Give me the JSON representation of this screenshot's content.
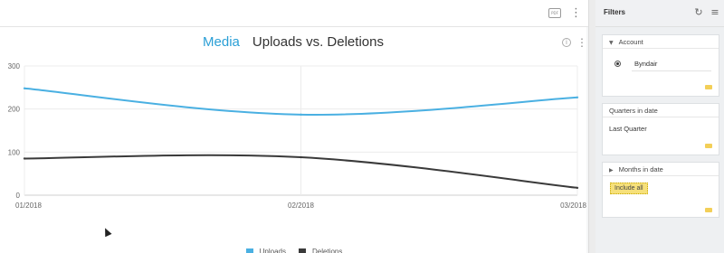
{
  "toolbar": {
    "pdf_label": "PDF",
    "more_label": "⋮"
  },
  "widget": {
    "title_prefix": "Media",
    "title": "Uploads vs. Deletions",
    "info_label": "i",
    "more_label": "⋮"
  },
  "chart_data": {
    "type": "line",
    "title": "Uploads vs. Deletions",
    "x": [
      "01/2018",
      "02/2018",
      "03/2018"
    ],
    "ylim": [
      0,
      300
    ],
    "yticks": [
      0,
      100,
      200,
      300
    ],
    "grid": true,
    "legend": "bottom",
    "series": [
      {
        "name": "Uploads",
        "color": "#4ab0e2",
        "values": [
          248,
          187,
          227
        ]
      },
      {
        "name": "Deletions",
        "color": "#3a3a3a",
        "values": [
          85,
          88,
          17
        ]
      }
    ]
  },
  "filters": {
    "title": "Filters",
    "refresh_icon": "refresh-icon",
    "menu_icon": "menu-icon",
    "account": {
      "label": "Account",
      "selected": "Byndair"
    },
    "quarters": {
      "label": "Quarters in date",
      "value": "Last Quarter"
    },
    "months": {
      "label": "Months in date",
      "chip": "Include all"
    }
  },
  "colors": {
    "accent": "#2a9fd6",
    "uploads": "#4ab0e2",
    "deletions": "#3a3a3a",
    "toggle": "#f3cf58",
    "chip": "#f6e07a"
  }
}
